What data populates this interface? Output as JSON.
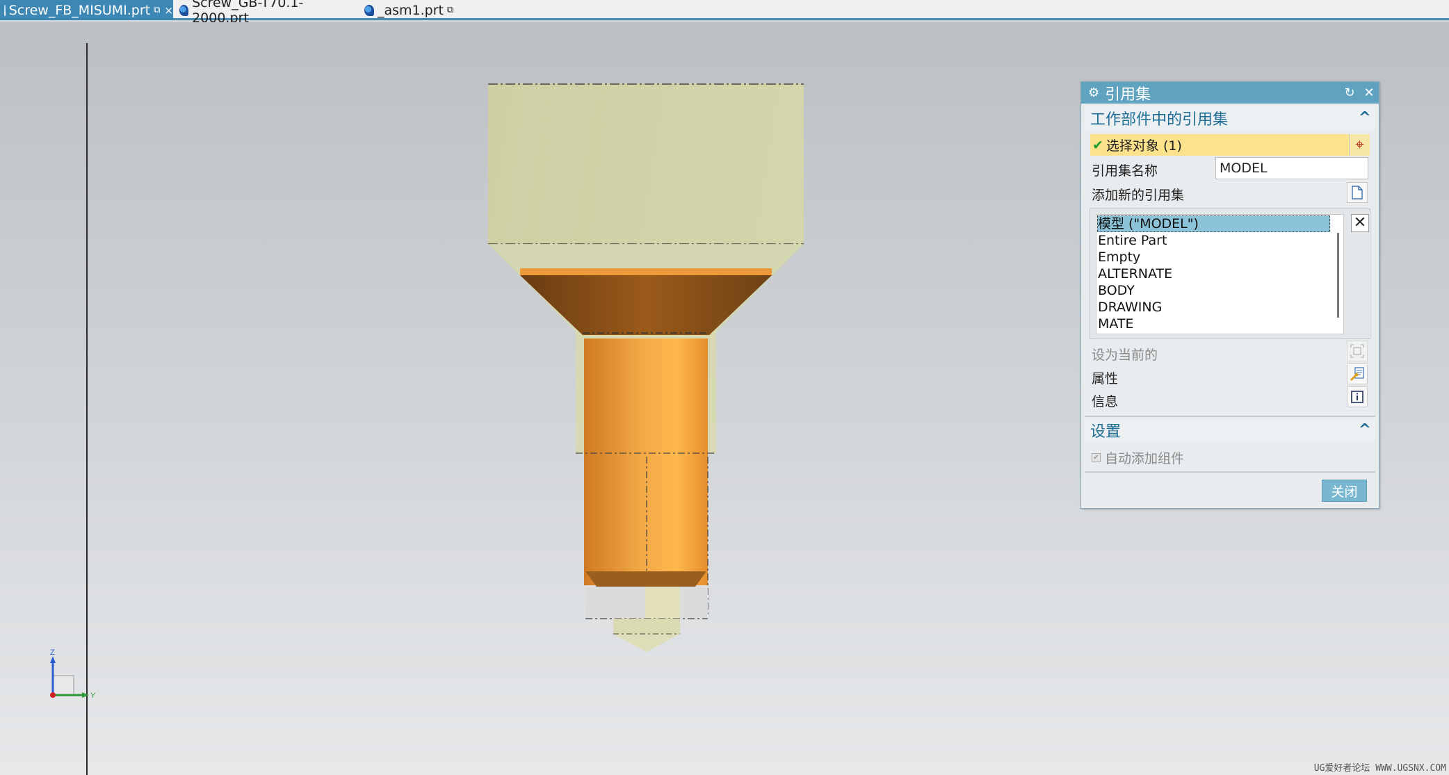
{
  "tabs": [
    {
      "label": "Screw_FB_MISUMI.prt",
      "mark": "⧉",
      "close": "×",
      "active": true
    },
    {
      "label": "Screw_GB-T70.1-2000.prt",
      "mark": "",
      "close": "",
      "active": false
    },
    {
      "label": "_asm1.prt",
      "mark": "⧉",
      "close": "",
      "active": false
    }
  ],
  "viewport": {
    "triad_labels": {
      "z": "Z",
      "y": "Y"
    },
    "watermark": "UG爱好者论坛 WWW.UGSNX.COM"
  },
  "dialog": {
    "title": "引用集",
    "title_icons": {
      "settings": "gear-icon",
      "reset": "reset-icon",
      "close": "close-icon"
    },
    "section_refsets": {
      "heading": "工作部件中的引用集",
      "select_objects": "选择对象 (1)",
      "refset_name_label": "引用集名称",
      "refset_name_value": "MODEL",
      "add_new_label": "添加新的引用集",
      "list_items": [
        "模型 (\"MODEL\")",
        "Entire Part",
        "Empty",
        "ALTERNATE",
        "BODY",
        "DRAWING",
        "MATE"
      ],
      "selected_index": 0,
      "set_current_label": "设为当前的",
      "properties_label": "属性",
      "info_label": "信息"
    },
    "section_settings": {
      "heading": "设置",
      "auto_add_components": "自动添加组件",
      "auto_add_checked": true,
      "auto_add_enabled": false
    },
    "close_button": "关闭"
  },
  "colors": {
    "accent": "#5fa3c0",
    "highlight": "#fce28b",
    "selection": "#8cc3d8",
    "orange_body": "#f5a23e",
    "ghost_body": "#d1d2a4"
  }
}
